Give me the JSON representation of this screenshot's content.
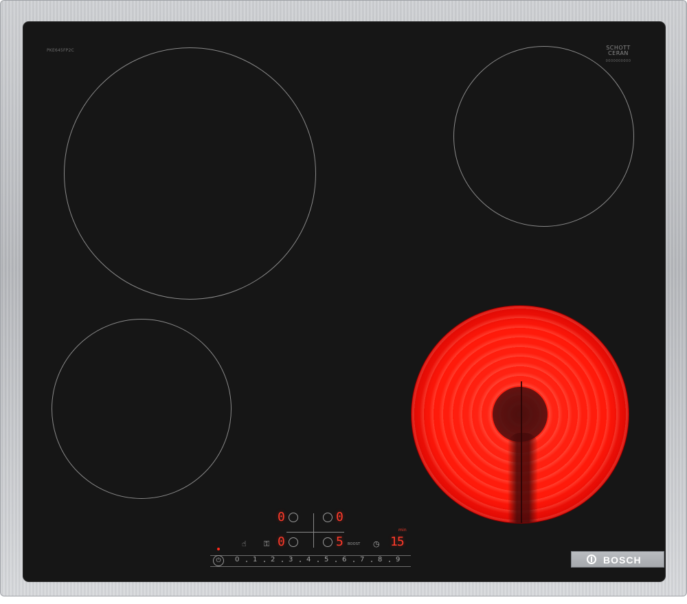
{
  "brand": {
    "name": "BOSCH"
  },
  "glass": {
    "model_code": "PKE645FP2C",
    "manufacturer": "SCHOTT",
    "material": "CERAN",
    "material_code": "0000000000"
  },
  "display": {
    "zone_top_left": "0",
    "zone_bottom_left": "0",
    "zone_top_right": "0",
    "zone_bottom_right": "5",
    "timer": "15",
    "timer_unit": "min"
  },
  "controls": {
    "boost_label": "BOOST",
    "power_icon": "power-icon",
    "scale": [
      "0",
      "1",
      "2",
      "3",
      "4",
      "5",
      "6",
      "7",
      "8",
      "9"
    ]
  },
  "colors": {
    "display_red": "#ff3a2a",
    "glass": "#161616",
    "active_zone": "#ff1a0a",
    "frame": "#c6c8cb"
  }
}
